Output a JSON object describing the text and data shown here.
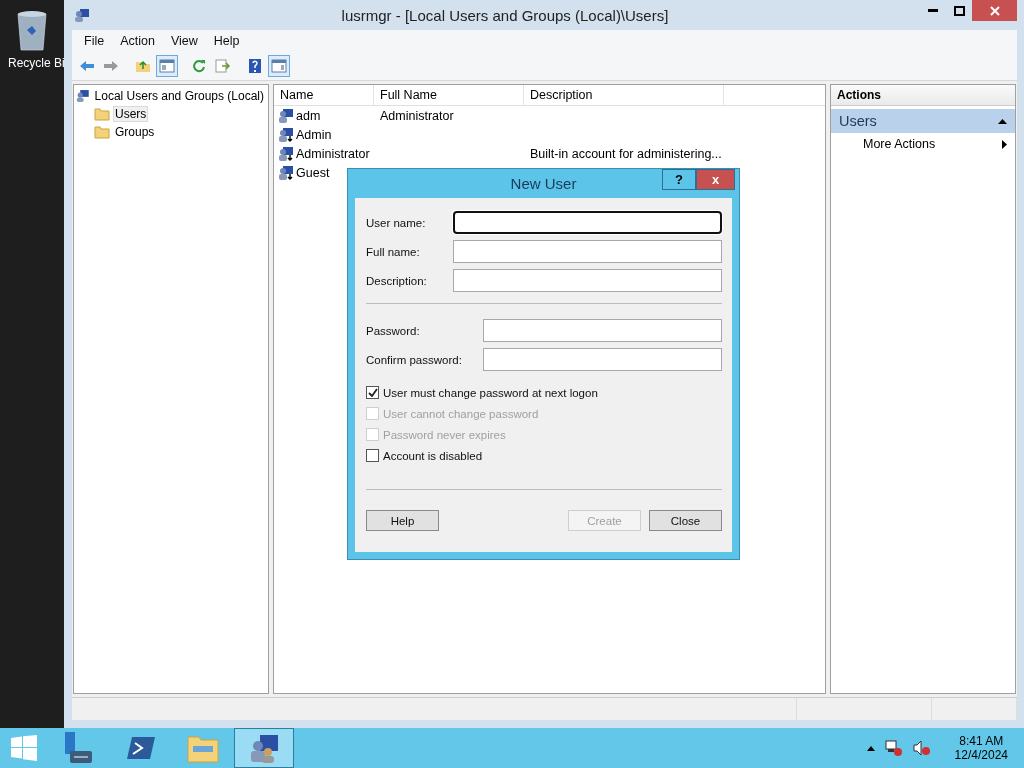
{
  "desktop": {
    "icon_label": "Recycle Bi"
  },
  "window": {
    "title": "lusrmgr - [Local Users and Groups (Local)\\Users]"
  },
  "menu": [
    "File",
    "Action",
    "View",
    "Help"
  ],
  "toolbar": [
    {
      "kind": "back",
      "pressed": false
    },
    {
      "kind": "forward",
      "pressed": false
    },
    {
      "kind": "up",
      "pressed": false
    },
    {
      "kind": "tree",
      "pressed": true
    },
    {
      "kind": "refresh",
      "pressed": false
    },
    {
      "kind": "export",
      "pressed": false
    },
    {
      "kind": "help",
      "pressed": false
    },
    {
      "kind": "pane",
      "pressed": true
    }
  ],
  "tree": {
    "label": "Local Users and Groups (Local)",
    "children": [
      {
        "label": "Users",
        "selected": true
      },
      {
        "label": "Groups",
        "selected": false
      }
    ]
  },
  "list": {
    "columns": [
      "Name",
      "Full Name",
      "Description"
    ],
    "rows": [
      {
        "name": "adm",
        "full_name": "Administrator",
        "description": "",
        "disabled": false
      },
      {
        "name": "Admin",
        "full_name": "",
        "description": "",
        "disabled": true
      },
      {
        "name": "Administrator",
        "full_name": "",
        "description": "Built-in account for administering...",
        "disabled": true
      },
      {
        "name": "Guest",
        "full_name": "",
        "description": "",
        "disabled": true
      }
    ]
  },
  "actions": {
    "title": "Actions",
    "section": "Users",
    "expanded": true,
    "items": [
      "More Actions"
    ]
  },
  "dialog": {
    "title": "New User",
    "help_button": "?",
    "close_button": "x",
    "fields": [
      {
        "label": "User name:",
        "focused": true,
        "kind": "account"
      },
      {
        "label": "Full name:",
        "focused": false,
        "kind": "account"
      },
      {
        "label": "Description:",
        "focused": false,
        "kind": "account"
      },
      {
        "label": "Password:",
        "focused": false,
        "kind": "password"
      },
      {
        "label": "Confirm password:",
        "focused": false,
        "kind": "password"
      }
    ],
    "checkboxes": [
      {
        "label": "User must change password at next logon",
        "checked": true,
        "disabled": false
      },
      {
        "label": "User cannot change password",
        "checked": false,
        "disabled": true
      },
      {
        "label": "Password never expires",
        "checked": false,
        "disabled": true
      },
      {
        "label": "Account is disabled",
        "checked": false,
        "disabled": false
      }
    ],
    "buttons": [
      {
        "label": "Help",
        "disabled": false
      },
      {
        "label": "Create",
        "disabled": true
      },
      {
        "label": "Close",
        "disabled": false
      }
    ]
  },
  "taskbar": {
    "apps": [
      {
        "kind": "server",
        "selected": false
      },
      {
        "kind": "shell",
        "selected": false
      },
      {
        "kind": "explorer",
        "selected": false
      },
      {
        "kind": "users",
        "selected": true
      }
    ],
    "time": "8:41 AM",
    "date": "12/4/2024"
  }
}
